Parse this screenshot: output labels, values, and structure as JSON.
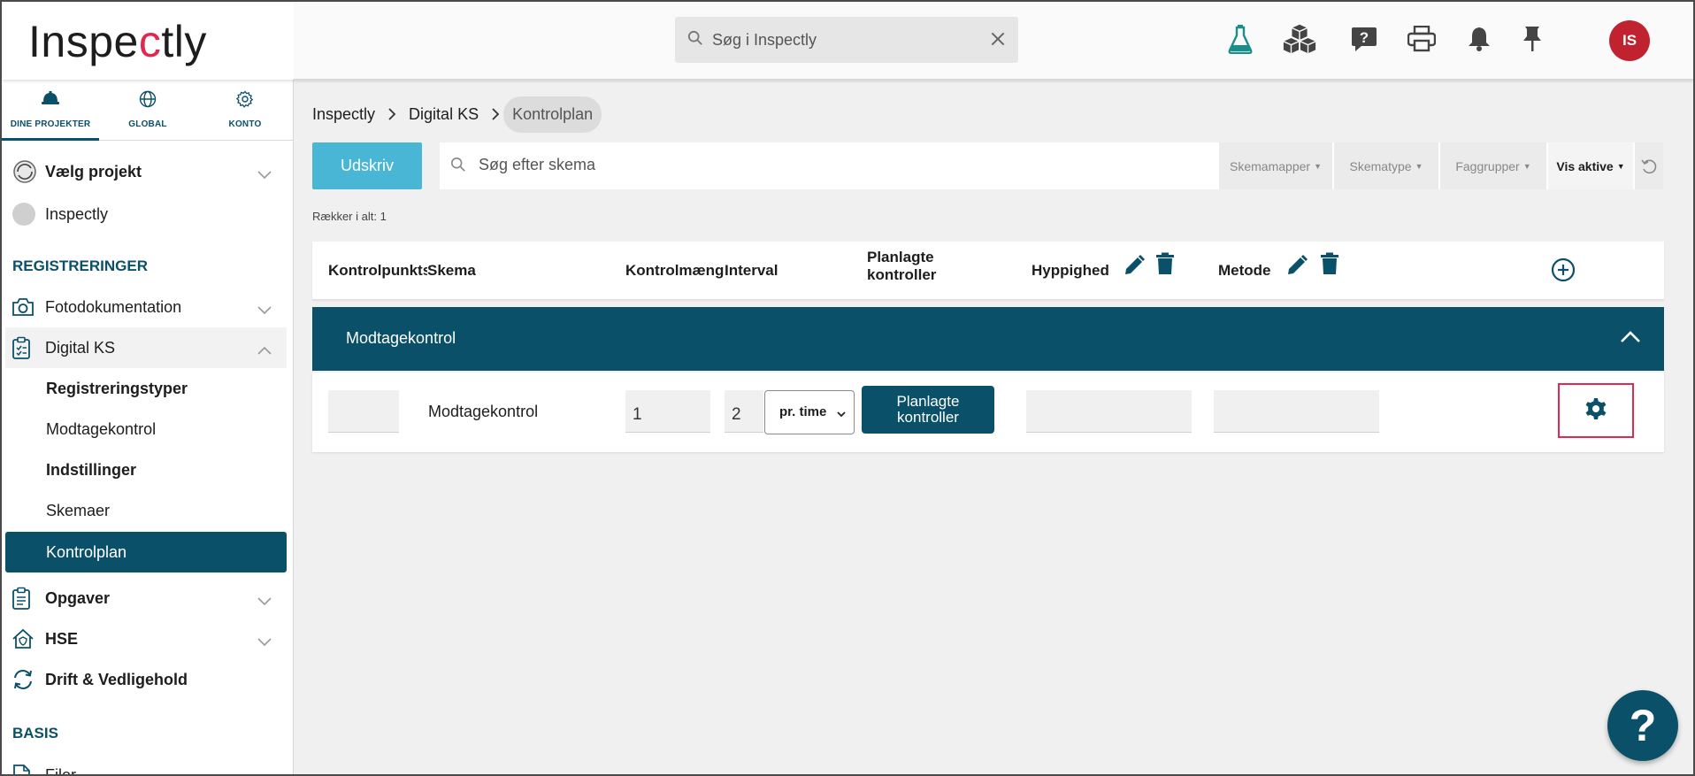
{
  "app": {
    "logo_text_a": "Inspe",
    "logo_text_hl": "c",
    "logo_text_b": "tly"
  },
  "search": {
    "placeholder": "Søg i Inspectly"
  },
  "user": {
    "initials": "IS"
  },
  "navtabs": [
    {
      "label": "DINE PROJEKTER",
      "icon": "helmet-icon"
    },
    {
      "label": "GLOBAL",
      "icon": "globe-icon"
    },
    {
      "label": "KONTO",
      "icon": "gear-icon"
    }
  ],
  "sidebar": {
    "project_select": "Vælg projekt",
    "project_name": "Inspectly",
    "section_registreringer": "REGISTRERINGER",
    "fotodok": "Fotodokumentation",
    "digital_ks": "Digital KS",
    "registreringstyper": "Registreringstyper",
    "modtagekontrol": "Modtagekontrol",
    "indstillinger": "Indstillinger",
    "skemaer": "Skemaer",
    "kontrolplan": "Kontrolplan",
    "opgaver": "Opgaver",
    "hse": "HSE",
    "drift": "Drift & Vedligehold",
    "section_basis": "BASIS",
    "filer": "Filer"
  },
  "breadcrumb": [
    "Inspectly",
    "Digital KS",
    "Kontrolplan"
  ],
  "toolbar": {
    "print_label": "Udskriv",
    "search_placeholder": "Søg efter skema",
    "filters": [
      "Skemamapper",
      "Skematype",
      "Faggrupper"
    ],
    "active_filter": "Vis aktive"
  },
  "rows_count": "Rækker i alt: 1",
  "table": {
    "headers": {
      "kontrolpunkt": "Kontrolpunktsnr.",
      "skema": "Skema",
      "kontrolmaengde": "Kontrolmængde",
      "interval": "Interval",
      "planlagte_1": "Planlagte",
      "planlagte_2": "kontroller",
      "hyppighed": "Hyppighed",
      "metode": "Metode"
    },
    "group": "Modtagekontrol",
    "row": {
      "skema": "Modtagekontrol",
      "kontrolmaengde": "1",
      "interval": "2",
      "interval_unit": "pr. time",
      "plan_btn_1": "Planlagte",
      "plan_btn_2": "kontroller"
    }
  },
  "colors": {
    "primary": "#0b5069",
    "accent": "#e0294e",
    "print_btn": "#49b6d6",
    "avatar": "#c0222f"
  },
  "help_label": "?"
}
